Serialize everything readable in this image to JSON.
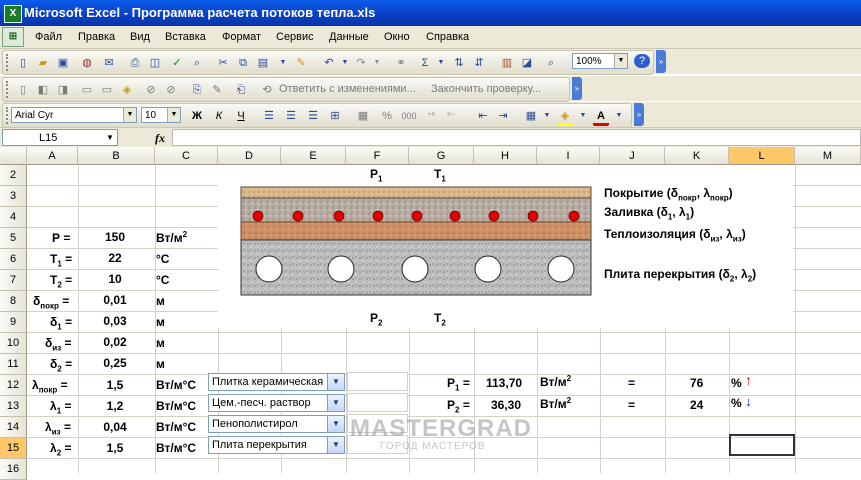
{
  "window": {
    "app_icon": "X",
    "title": "Microsoft Excel - Программа расчета потоков тепла.xls"
  },
  "menu": [
    {
      "label": "Файл"
    },
    {
      "label": "Правка"
    },
    {
      "label": "Вид"
    },
    {
      "label": "Вставка"
    },
    {
      "label": "Формат"
    },
    {
      "label": "Сервис"
    },
    {
      "label": "Данные"
    },
    {
      "label": "Окно"
    },
    {
      "label": "Справка"
    }
  ],
  "toolbar": {
    "zoom": "100%",
    "reply_changes": "Ответить с изменениями...",
    "end_review": "Закончить проверку...",
    "font_name": "Arial Cyr",
    "font_size": "10",
    "bold": "Ж",
    "italic": "К",
    "underline": "Ч",
    "percent": "%",
    "thousands": "000"
  },
  "formula_bar": {
    "name_box": "L15",
    "fx": "fx",
    "formula": ""
  },
  "columns": [
    "A",
    "B",
    "C",
    "D",
    "E",
    "F",
    "G",
    "H",
    "I",
    "J",
    "K",
    "L",
    "M"
  ],
  "selected_column": "L",
  "rows": [
    "2",
    "3",
    "4",
    "5",
    "6",
    "7",
    "8",
    "9",
    "10",
    "11",
    "12",
    "13",
    "14",
    "15",
    "16"
  ],
  "selected_row": "15",
  "diagram": {
    "top_labels": [
      "P",
      "1",
      "T",
      "1"
    ],
    "bottom_labels": [
      "P",
      "2",
      "T",
      "2"
    ],
    "layers": [
      {
        "name": "Покрытие (δпокр, λпокр)",
        "color": "#d8b889"
      },
      {
        "name": "Заливка (δ1, λ1)",
        "color": "#b9aea5"
      },
      {
        "name": "Теплоизоляция (δиз, λиз)",
        "color": "#cd9064"
      },
      {
        "name": "Плита перекрытия (δ2, λ2)",
        "color": "#bcbcbc"
      }
    ],
    "layer_text": {
      "cover": [
        "Покрытие (",
        "δ",
        "покр",
        ", ",
        "λ",
        "покр",
        ")"
      ],
      "fill": [
        "Заливка (",
        "δ",
        "1",
        ", ",
        "λ",
        "1",
        ")"
      ],
      "insul": [
        "Теплоизоляция (",
        "δ",
        "из",
        ", ",
        "λ",
        "из",
        ")"
      ],
      "slab": [
        "Плита перекрытия (",
        "δ",
        "2",
        ", ",
        "λ",
        "2",
        ")"
      ]
    }
  },
  "inputs": [
    {
      "sym": "P",
      "sub": "",
      "value": "150",
      "unit": "Вт/м",
      "unit_sup": "2"
    },
    {
      "sym": "T",
      "sub": "1",
      "value": "22",
      "unit": "°C",
      "unit_sup": ""
    },
    {
      "sym": "T",
      "sub": "2",
      "value": "10",
      "unit": "°C",
      "unit_sup": ""
    },
    {
      "sym": "δ",
      "sub": "покр",
      "value": "0,01",
      "unit": "м",
      "unit_sup": ""
    },
    {
      "sym": "δ",
      "sub": "1",
      "value": "0,03",
      "unit": "м",
      "unit_sup": ""
    },
    {
      "sym": "δ",
      "sub": "из",
      "value": "0,02",
      "unit": "м",
      "unit_sup": ""
    },
    {
      "sym": "δ",
      "sub": "2",
      "value": "0,25",
      "unit": "м",
      "unit_sup": ""
    }
  ],
  "eq": "=",
  "lambdas": [
    {
      "sym": "λ",
      "sub": "покр",
      "value": "1,5",
      "unit": "Вт/м°C",
      "material": "Плитка керамическая"
    },
    {
      "sym": "λ",
      "sub": "1",
      "value": "1,2",
      "unit": "Вт/м°C",
      "material": "Цем.-песч. раствор"
    },
    {
      "sym": "λ",
      "sub": "из",
      "value": "0,04",
      "unit": "Вт/м°C",
      "material": "Пенополистирол"
    },
    {
      "sym": "λ",
      "sub": "2",
      "value": "1,5",
      "unit": "Вт/м°C",
      "material": "Плита перекрытия"
    }
  ],
  "results": [
    {
      "sym": "P",
      "sub": "1",
      "value": "113,70",
      "unit": "Вт/м",
      "unit_sup": "2",
      "eq": "=",
      "percent": "76",
      "pct": "%",
      "arrow": "↑",
      "arrow_color": "#e00000"
    },
    {
      "sym": "P",
      "sub": "2",
      "value": "36,30",
      "unit": "Вт/м",
      "unit_sup": "2",
      "eq": "=",
      "percent": "24",
      "pct": "%",
      "arrow": "↓",
      "arrow_color": "#0033dd"
    }
  ],
  "watermark": {
    "main": "MASTERGRAD",
    "sub": "ГОРОД МАСТЕРОВ"
  },
  "colors": {
    "title_bar": "#0a49d0",
    "selection_header": "#ffc76a",
    "heater_dot": "#e00000"
  }
}
